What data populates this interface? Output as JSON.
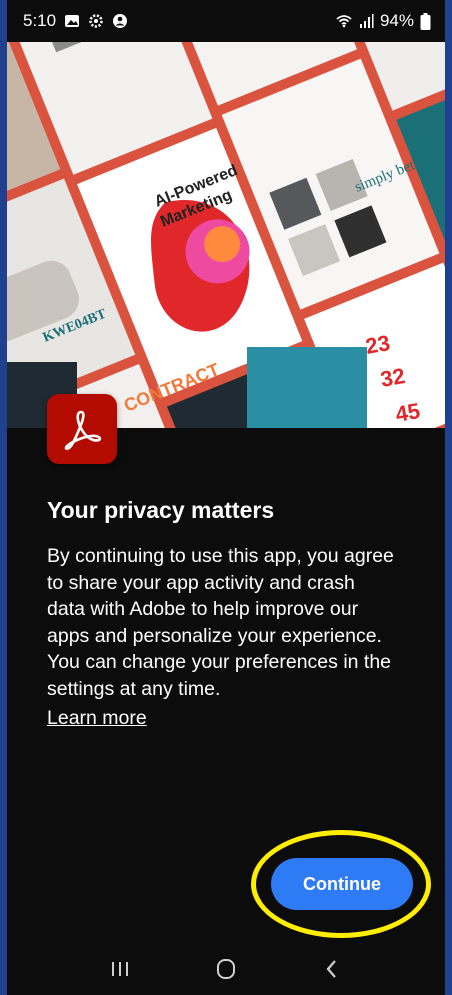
{
  "status_bar": {
    "time": "5:10",
    "battery": "94%",
    "left_icons": [
      "gallery-icon",
      "settings-gear-icon",
      "account-circle-icon"
    ],
    "right_icons": [
      "wifi-icon",
      "signal-icon",
      "battery-icon"
    ]
  },
  "hero": {
    "collage_texts": {
      "ai_powered": "AI-Powered",
      "marketing": "Marketing",
      "simply_better": "simply better.",
      "kwe": "KWE04BT",
      "contract": "CONTRACT",
      "n23": "23",
      "n32": "32",
      "n45": "45"
    }
  },
  "app": {
    "icon": "adobe-acrobat-icon"
  },
  "content": {
    "title": "Your privacy matters",
    "body": "By continuing to use this app, you agree to share your app activity and crash data with Adobe to help improve our apps and personalize your experience. You can change your preferences in the settings at any time.",
    "learn_more": "Learn more"
  },
  "actions": {
    "continue_label": "Continue"
  },
  "colors": {
    "primary_button": "#2f7bf5",
    "highlight_ring": "#ffee00",
    "acrobat_red": "#b30b00",
    "background": "#0c0c0c"
  },
  "nav_bar": {
    "buttons": [
      "recents-icon",
      "home-icon",
      "back-icon"
    ]
  }
}
